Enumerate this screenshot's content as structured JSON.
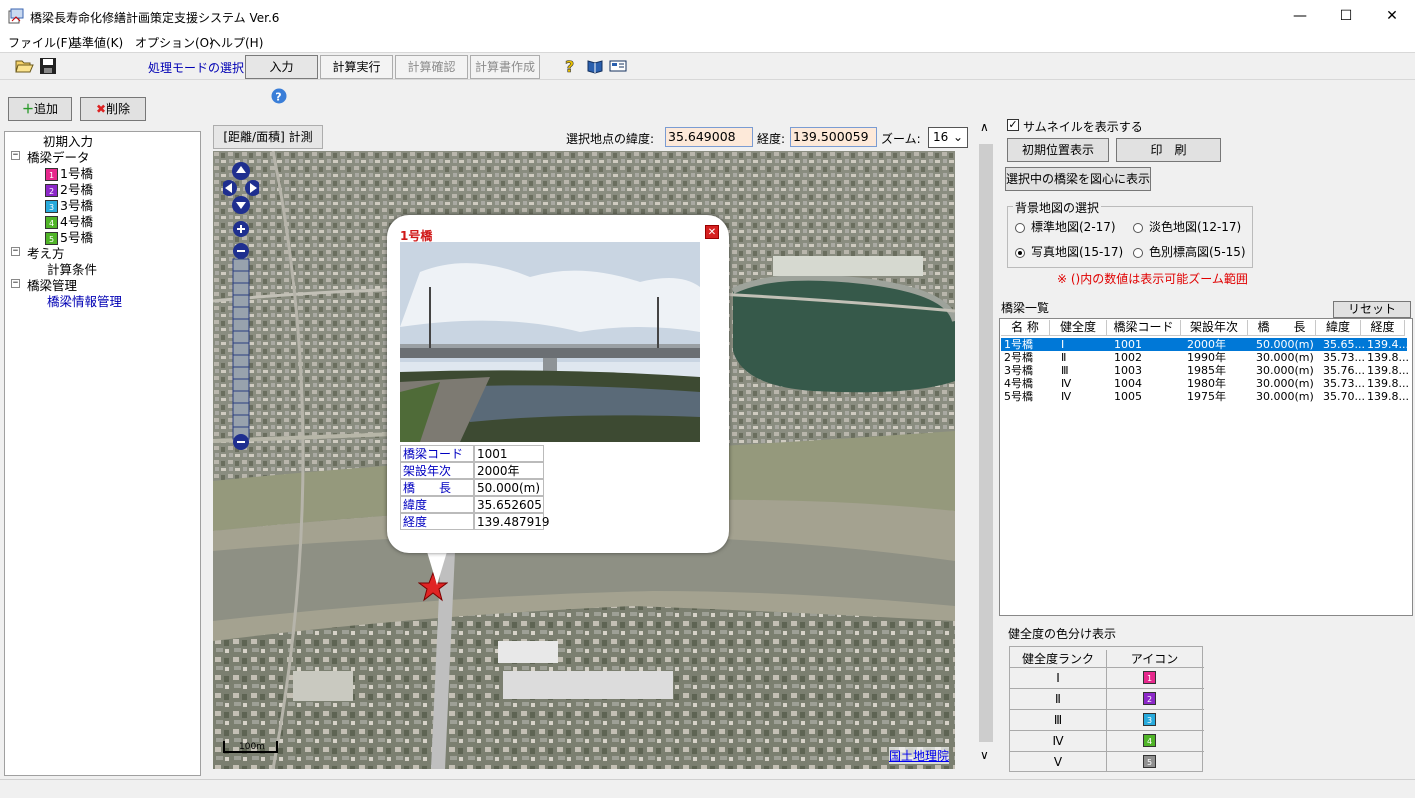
{
  "window": {
    "title": "橋梁長寿命化修繕計画策定支援システム Ver.6",
    "minimize": "—",
    "maximize": "☐",
    "close": "✕"
  },
  "menu": [
    "ファイル(F)",
    "基準値(K)",
    "オプション(O)",
    "ヘルプ(H)"
  ],
  "toolbar": {
    "mode_label": "処理モードの選択",
    "modes": [
      {
        "label": "入力",
        "state": "active"
      },
      {
        "label": "計算実行",
        "state": "enabled"
      },
      {
        "label": "計算確認",
        "state": "disabled"
      },
      {
        "label": "計算書作成",
        "state": "disabled"
      }
    ]
  },
  "left": {
    "add": "追加",
    "delete": "削除"
  },
  "tree": {
    "initial": "初期入力",
    "bridge_data": "橋梁データ",
    "bridges": [
      {
        "label": "1号橋",
        "n": "1",
        "color": "#e6288c"
      },
      {
        "label": "2号橋",
        "n": "2",
        "color": "#8c28c8"
      },
      {
        "label": "3号橋",
        "n": "3",
        "color": "#28aadc"
      },
      {
        "label": "4号橋",
        "n": "4",
        "color": "#50b428"
      },
      {
        "label": "5号橋",
        "n": "5",
        "color": "#50b428"
      }
    ],
    "approach": "考え方",
    "calc_cond": "計算条件",
    "mgmt": "橋梁管理",
    "info_mgmt": "橋梁情報管理",
    "collapse": "−"
  },
  "map": {
    "measure_tab": "[距離/面積] 計測",
    "lat_label": "選択地点の緯度:",
    "lat": "35.649008",
    "lng_label": "経度:",
    "lng": "139.500059",
    "zoom_label": "ズーム:",
    "zoom": "16",
    "scale": "100m",
    "credit": "国土地理院"
  },
  "popup": {
    "title": "1号橋",
    "rows": [
      {
        "k": "橋梁コード",
        "v": "1001"
      },
      {
        "k": "架設年次",
        "v": "2000年"
      },
      {
        "k": "橋　　長",
        "v": "50.000(m)"
      },
      {
        "k": "緯度",
        "v": "35.652605"
      },
      {
        "k": "経度",
        "v": "139.487919"
      }
    ]
  },
  "right": {
    "thumb": "サムネイルを表示する",
    "init_pos": "初期位置表示",
    "print": "印　刷",
    "center": "選択中の橋梁を図心に表示",
    "bg_group": "背景地図の選択",
    "bg": [
      {
        "label": "標準地図(2-17)",
        "on": false
      },
      {
        "label": "淡色地図(12-17)",
        "on": false
      },
      {
        "label": "写真地図(15-17)",
        "on": true
      },
      {
        "label": "色別標高図(5-15)",
        "on": false
      }
    ],
    "note": "※ ()内の数値は表示可能ズーム範囲",
    "list_title": "橋梁一覧",
    "reset": "リセット"
  },
  "grid": {
    "headers": [
      "名 称",
      "健全度",
      "橋梁コード",
      "架設年次",
      "橋　　長",
      "緯度",
      "経度"
    ],
    "rows": [
      [
        "1号橋",
        "Ⅰ",
        "1001",
        "2000年",
        "50.000(m)",
        "35.65...",
        "139.4..."
      ],
      [
        "2号橋",
        "Ⅱ",
        "1002",
        "1990年",
        "30.000(m)",
        "35.73...",
        "139.8..."
      ],
      [
        "3号橋",
        "Ⅲ",
        "1003",
        "1985年",
        "30.000(m)",
        "35.76...",
        "139.8..."
      ],
      [
        "4号橋",
        "Ⅳ",
        "1004",
        "1980年",
        "30.000(m)",
        "35.73...",
        "139.8..."
      ],
      [
        "5号橋",
        "Ⅳ",
        "1005",
        "1975年",
        "30.000(m)",
        "35.70...",
        "139.8..."
      ]
    ]
  },
  "legend": {
    "title": "健全度の色分け表示",
    "h1": "健全度ランク",
    "h2": "アイコン",
    "rows": [
      {
        "rank": "Ⅰ",
        "n": "1",
        "color": "#e6288c"
      },
      {
        "rank": "Ⅱ",
        "n": "2",
        "color": "#8c28c8"
      },
      {
        "rank": "Ⅲ",
        "n": "3",
        "color": "#28aadc"
      },
      {
        "rank": "Ⅳ",
        "n": "4",
        "color": "#50b428"
      },
      {
        "rank": "Ⅴ",
        "n": "5",
        "color": "#909090"
      }
    ]
  }
}
